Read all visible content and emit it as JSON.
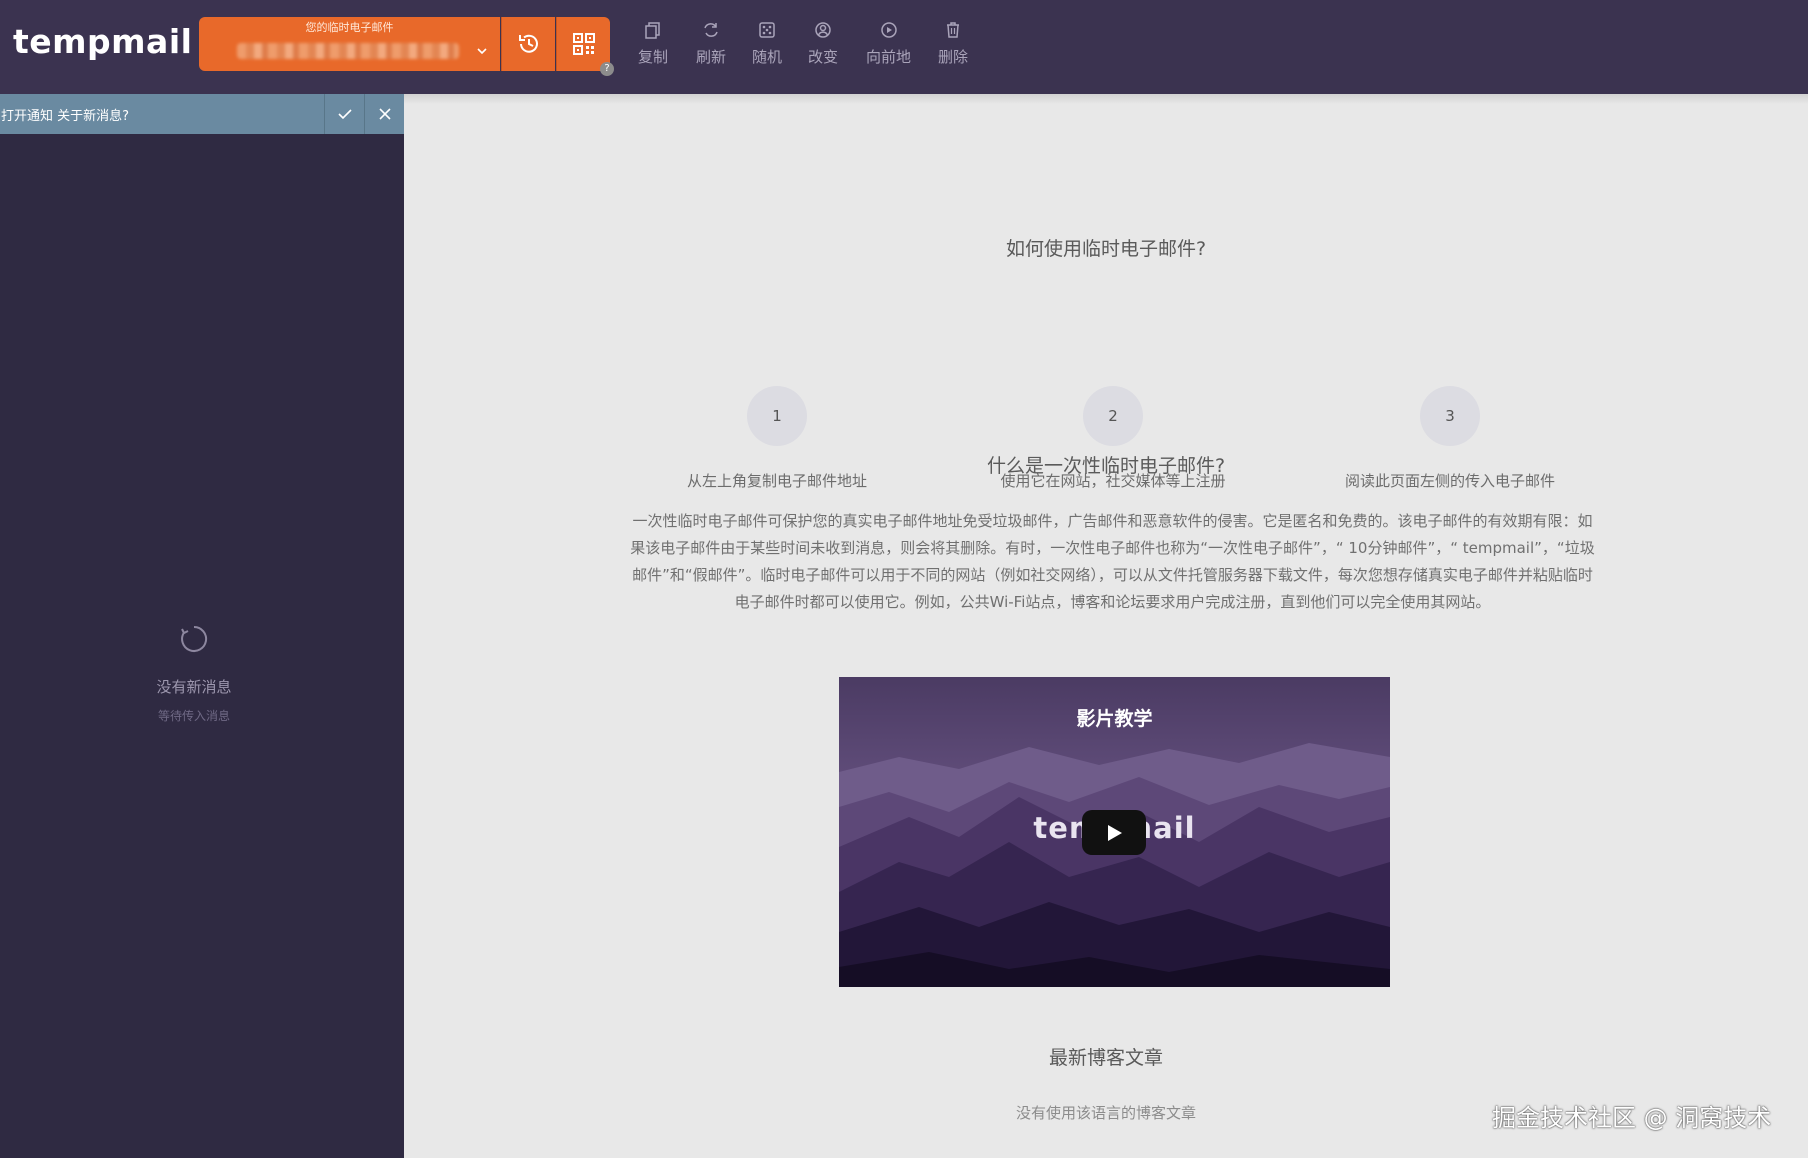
{
  "app": {
    "logo": "tempmail"
  },
  "email": {
    "caption": "您的临时电子邮件",
    "value_redacted": true
  },
  "header_buttons": {
    "history_icon": "history-icon",
    "qr_icon": "qr-code-icon",
    "help_badge": "?"
  },
  "toolbar": [
    {
      "label": "复制",
      "icon": "copy-icon"
    },
    {
      "label": "刷新",
      "icon": "refresh-icon"
    },
    {
      "label": "随机",
      "icon": "dice-icon"
    },
    {
      "label": "改变",
      "icon": "change-icon"
    },
    {
      "label": "向前地",
      "icon": "forward-icon"
    },
    {
      "label": "删除",
      "icon": "trash-icon"
    }
  ],
  "notify": {
    "text": "打开通知 关于新消息?"
  },
  "inbox": {
    "empty_title": "没有新消息",
    "empty_subtitle": "等待传入消息"
  },
  "how_to": {
    "title": "如何使用临时电子邮件?",
    "steps": [
      {
        "num": "1",
        "text": "从左上角复制电子邮件地址"
      },
      {
        "num": "2",
        "text": "使用它在网站，社交媒体等上注册"
      },
      {
        "num": "3",
        "text": "阅读此页面左侧的传入电子邮件"
      }
    ]
  },
  "what_is": {
    "title": "什么是一次性临时电子邮件?",
    "text": "一次性临时电子邮件可保护您的真实电子邮件地址免受垃圾邮件，广告邮件和恶意软件的侵害。它是匿名和免费的。该电子邮件的有效期有限：如果该电子邮件由于某些时间未收到消息，则会将其删除。有时，一次性电子邮件也称为“一次性电子邮件”，“ 10分钟邮件”，“ tempmail”，“垃圾邮件”和“假邮件”。临时电子邮件可以用于不同的网站（例如社交网络），可以从文件托管服务器下载文件，每次您想存储真实电子邮件并粘贴临时电子邮件时都可以使用它。例如，公共Wi-Fi站点，博客和论坛要求用户完成注册，直到他们可以完全使用其网站。"
  },
  "video": {
    "title": "影片教学",
    "brand": "tempmail"
  },
  "blog": {
    "title": "最新博客文章",
    "empty": "没有使用该语言的博客文章"
  },
  "watermark": "掘金技术社区 @ 洞窝技术",
  "colors": {
    "header": "#3b3350",
    "accent": "#e8692a",
    "sidebar": "#2f2a42",
    "notify": "#6a8aa1",
    "main_bg": "#e8e8e8"
  }
}
